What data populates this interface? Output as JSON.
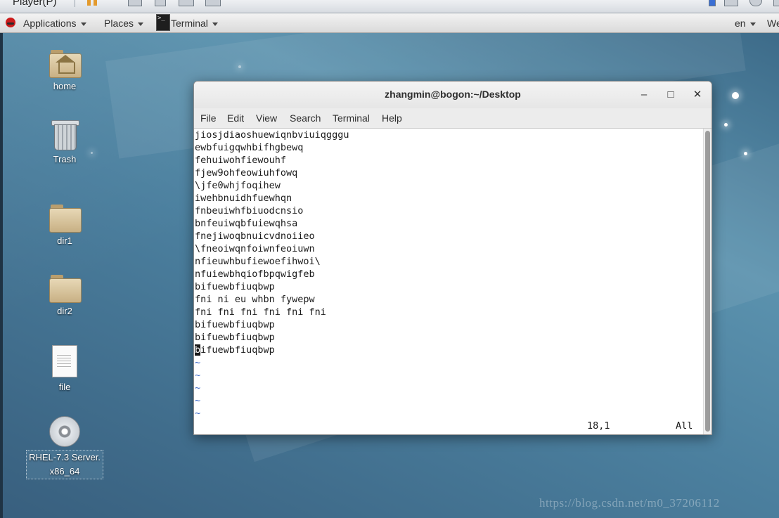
{
  "player": {
    "label": "Player(P)"
  },
  "top_bar": {
    "applications": "Applications",
    "places": "Places",
    "terminal": "Terminal",
    "language": "en",
    "user_menu": "We"
  },
  "desktop_icons": [
    {
      "name": "home",
      "icon": "home-folder-icon"
    },
    {
      "name": "Trash",
      "icon": "trash-icon"
    },
    {
      "name": "dir1",
      "icon": "folder-icon"
    },
    {
      "name": "dir2",
      "icon": "folder-icon"
    },
    {
      "name": "file",
      "icon": "text-file-icon"
    },
    {
      "name_line1": "RHEL-7.3 Server.",
      "name_line2": "x86_64",
      "icon": "disc-icon"
    }
  ],
  "window": {
    "title": "zhangmin@bogon:~/Desktop",
    "minimize": "–",
    "maximize": "□",
    "close": "✕",
    "menus": [
      "File",
      "Edit",
      "View",
      "Search",
      "Terminal",
      "Help"
    ]
  },
  "vim": {
    "lines": [
      "jiosjdiaoshuewiqnbviuiqgggu",
      "ewbfuigqwhbifhgbewq",
      "fehuiwohfiewouhf",
      "fjew9ohfeowiuhfowq",
      "\\jfe0whjfoqihew",
      "iwehbnuidhfuewhqn",
      "fnbeuiwhfbiuodcnsio",
      "bnfeuiwqbfuiewqhsa",
      "fnejiwoqbnuicvdnoiieo",
      "\\fneoiwqnfoiwnfeoiuwn",
      "nfieuwhbufiewoefihwoi\\",
      "nfuiewbhqiofbpqwigfeb",
      "bifuewbfiuqbwp",
      "fni ni eu whbn fywepw",
      "fni fni fni fni fni fni",
      "bifuewbfiuqbwp",
      "bifuewbfiuqbwp"
    ],
    "cursor_line_char": "b",
    "cursor_line_rest": "ifuewbfiuqbwp",
    "tildes": [
      "~",
      "~",
      "~",
      "~",
      "~"
    ],
    "status_position": "18,1",
    "status_scroll": "All"
  },
  "watermark": "https://blog.csdn.net/m0_37206112",
  "colors": {
    "tilde": "#3a68c8",
    "desktop": "#4b7f9e"
  }
}
